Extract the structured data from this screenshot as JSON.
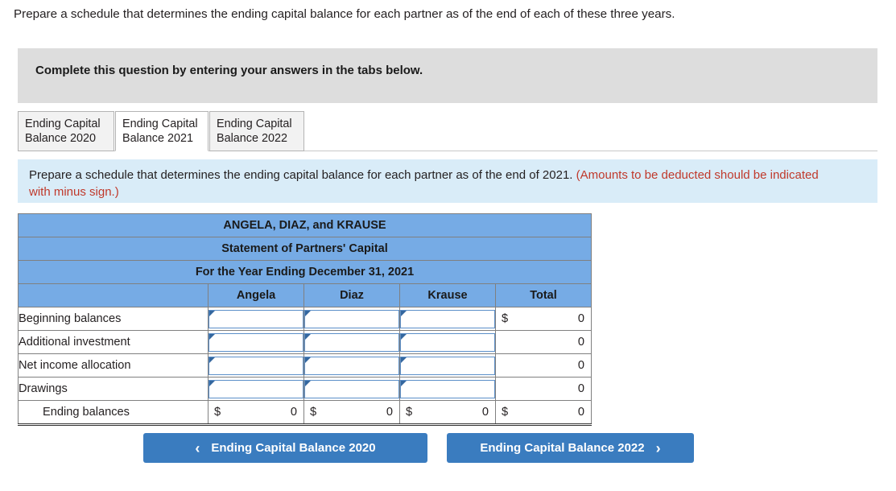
{
  "top_prompt": "Prepare a schedule that determines the ending capital balance for each partner as of the end of each of these three years.",
  "gray_banner": {
    "text": "Complete this question by entering your answers in the tabs below."
  },
  "tabs": [
    {
      "line1": "Ending Capital",
      "line2": "Balance 2020",
      "active": false
    },
    {
      "line1": "Ending Capital",
      "line2": "Balance 2021",
      "active": true
    },
    {
      "line1": "Ending Capital",
      "line2": "Balance 2022",
      "active": false
    }
  ],
  "info_box": {
    "black_text": "Prepare a schedule that determines the ending capital balance for each partner as of the end of 2021.",
    "red_text": "(Amounts to be deducted should be indicated with minus sign.)"
  },
  "statement": {
    "title_line1": "ANGELA, DIAZ, and KRAUSE",
    "title_line2": "Statement of Partners' Capital",
    "title_line3": "For the Year Ending December 31, 2021",
    "column_headers": [
      "",
      "Angela",
      "Diaz",
      "Krause",
      "Total"
    ],
    "rows": [
      {
        "label": "Beginning balances",
        "indent": false,
        "angela": {
          "type": "input",
          "value": ""
        },
        "diaz": {
          "type": "input",
          "value": ""
        },
        "krause": {
          "type": "input",
          "value": ""
        },
        "total": {
          "type": "value",
          "dollar": "$",
          "number": "0"
        }
      },
      {
        "label": "Additional investment",
        "indent": false,
        "angela": {
          "type": "input",
          "value": ""
        },
        "diaz": {
          "type": "input",
          "value": ""
        },
        "krause": {
          "type": "input",
          "value": ""
        },
        "total": {
          "type": "value",
          "dollar": "",
          "number": "0"
        }
      },
      {
        "label": "Net income allocation",
        "indent": false,
        "angela": {
          "type": "input",
          "value": ""
        },
        "diaz": {
          "type": "input",
          "value": ""
        },
        "krause": {
          "type": "input",
          "value": ""
        },
        "total": {
          "type": "value",
          "dollar": "",
          "number": "0"
        }
      },
      {
        "label": "Drawings",
        "indent": false,
        "angela": {
          "type": "input",
          "value": ""
        },
        "diaz": {
          "type": "input",
          "value": ""
        },
        "krause": {
          "type": "input",
          "value": ""
        },
        "total": {
          "type": "value",
          "dollar": "",
          "number": "0"
        }
      },
      {
        "label": "Ending balances",
        "indent": true,
        "angela": {
          "type": "value",
          "dollar": "$",
          "number": "0"
        },
        "diaz": {
          "type": "value",
          "dollar": "$",
          "number": "0"
        },
        "krause": {
          "type": "value",
          "dollar": "$",
          "number": "0"
        },
        "total": {
          "type": "value",
          "dollar": "$",
          "number": "0"
        }
      }
    ]
  },
  "buttons": {
    "prev": {
      "label": "Ending Capital Balance 2020",
      "chevron": "‹"
    },
    "next": {
      "label": "Ending Capital Balance 2022",
      "chevron": "›"
    }
  },
  "colors": {
    "header_blue": "#76abe5",
    "info_blue": "#d9ecf8",
    "banner_gray": "#dddddd",
    "button_blue": "#3a7cbf",
    "red_text": "#c0392b",
    "input_border": "#5b8fc9"
  }
}
